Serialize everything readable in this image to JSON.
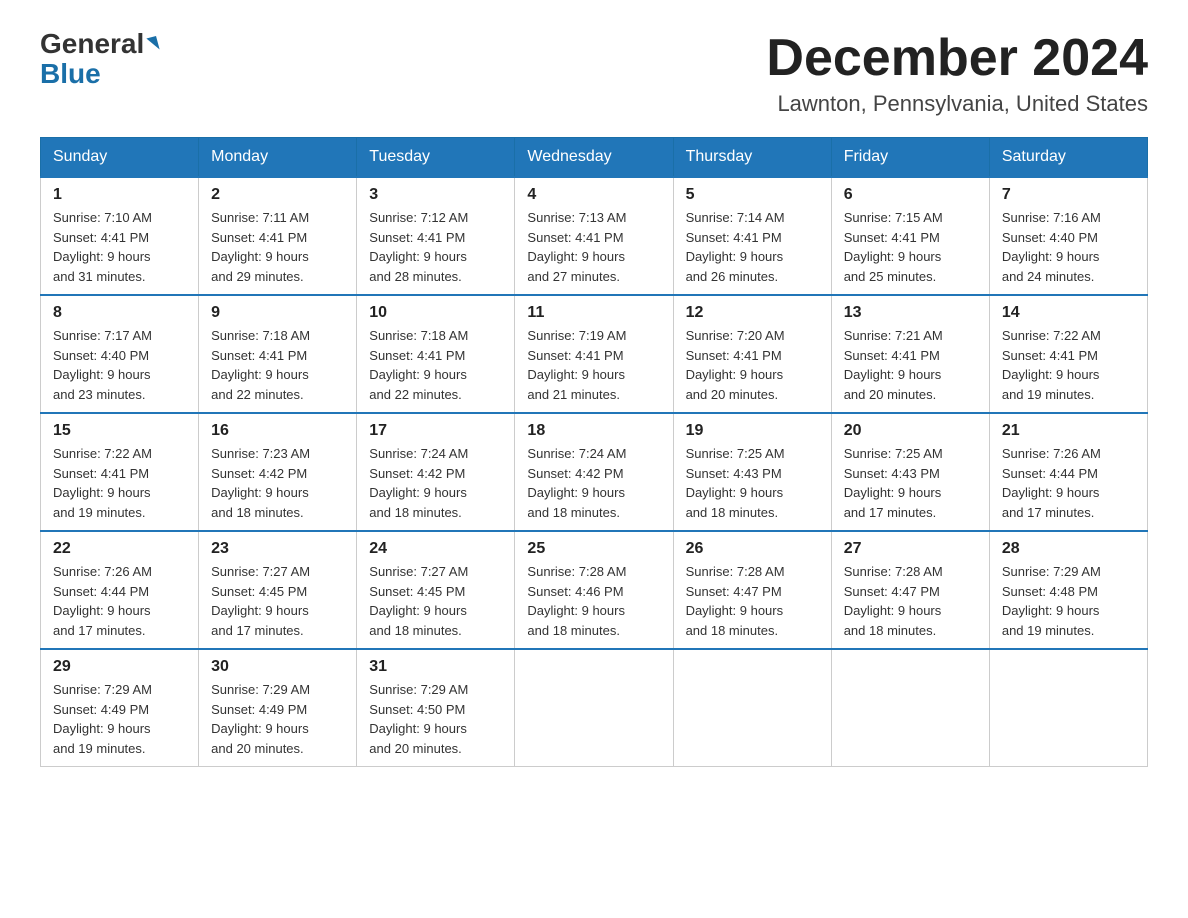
{
  "header": {
    "logo_general": "General",
    "logo_blue": "Blue",
    "month_title": "December 2024",
    "location": "Lawnton, Pennsylvania, United States"
  },
  "days_of_week": [
    "Sunday",
    "Monday",
    "Tuesday",
    "Wednesday",
    "Thursday",
    "Friday",
    "Saturday"
  ],
  "weeks": [
    [
      {
        "day": 1,
        "sunrise": "7:10 AM",
        "sunset": "4:41 PM",
        "daylight": "9 hours and 31 minutes."
      },
      {
        "day": 2,
        "sunrise": "7:11 AM",
        "sunset": "4:41 PM",
        "daylight": "9 hours and 29 minutes."
      },
      {
        "day": 3,
        "sunrise": "7:12 AM",
        "sunset": "4:41 PM",
        "daylight": "9 hours and 28 minutes."
      },
      {
        "day": 4,
        "sunrise": "7:13 AM",
        "sunset": "4:41 PM",
        "daylight": "9 hours and 27 minutes."
      },
      {
        "day": 5,
        "sunrise": "7:14 AM",
        "sunset": "4:41 PM",
        "daylight": "9 hours and 26 minutes."
      },
      {
        "day": 6,
        "sunrise": "7:15 AM",
        "sunset": "4:41 PM",
        "daylight": "9 hours and 25 minutes."
      },
      {
        "day": 7,
        "sunrise": "7:16 AM",
        "sunset": "4:40 PM",
        "daylight": "9 hours and 24 minutes."
      }
    ],
    [
      {
        "day": 8,
        "sunrise": "7:17 AM",
        "sunset": "4:40 PM",
        "daylight": "9 hours and 23 minutes."
      },
      {
        "day": 9,
        "sunrise": "7:18 AM",
        "sunset": "4:41 PM",
        "daylight": "9 hours and 22 minutes."
      },
      {
        "day": 10,
        "sunrise": "7:18 AM",
        "sunset": "4:41 PM",
        "daylight": "9 hours and 22 minutes."
      },
      {
        "day": 11,
        "sunrise": "7:19 AM",
        "sunset": "4:41 PM",
        "daylight": "9 hours and 21 minutes."
      },
      {
        "day": 12,
        "sunrise": "7:20 AM",
        "sunset": "4:41 PM",
        "daylight": "9 hours and 20 minutes."
      },
      {
        "day": 13,
        "sunrise": "7:21 AM",
        "sunset": "4:41 PM",
        "daylight": "9 hours and 20 minutes."
      },
      {
        "day": 14,
        "sunrise": "7:22 AM",
        "sunset": "4:41 PM",
        "daylight": "9 hours and 19 minutes."
      }
    ],
    [
      {
        "day": 15,
        "sunrise": "7:22 AM",
        "sunset": "4:41 PM",
        "daylight": "9 hours and 19 minutes."
      },
      {
        "day": 16,
        "sunrise": "7:23 AM",
        "sunset": "4:42 PM",
        "daylight": "9 hours and 18 minutes."
      },
      {
        "day": 17,
        "sunrise": "7:24 AM",
        "sunset": "4:42 PM",
        "daylight": "9 hours and 18 minutes."
      },
      {
        "day": 18,
        "sunrise": "7:24 AM",
        "sunset": "4:42 PM",
        "daylight": "9 hours and 18 minutes."
      },
      {
        "day": 19,
        "sunrise": "7:25 AM",
        "sunset": "4:43 PM",
        "daylight": "9 hours and 18 minutes."
      },
      {
        "day": 20,
        "sunrise": "7:25 AM",
        "sunset": "4:43 PM",
        "daylight": "9 hours and 17 minutes."
      },
      {
        "day": 21,
        "sunrise": "7:26 AM",
        "sunset": "4:44 PM",
        "daylight": "9 hours and 17 minutes."
      }
    ],
    [
      {
        "day": 22,
        "sunrise": "7:26 AM",
        "sunset": "4:44 PM",
        "daylight": "9 hours and 17 minutes."
      },
      {
        "day": 23,
        "sunrise": "7:27 AM",
        "sunset": "4:45 PM",
        "daylight": "9 hours and 17 minutes."
      },
      {
        "day": 24,
        "sunrise": "7:27 AM",
        "sunset": "4:45 PM",
        "daylight": "9 hours and 18 minutes."
      },
      {
        "day": 25,
        "sunrise": "7:28 AM",
        "sunset": "4:46 PM",
        "daylight": "9 hours and 18 minutes."
      },
      {
        "day": 26,
        "sunrise": "7:28 AM",
        "sunset": "4:47 PM",
        "daylight": "9 hours and 18 minutes."
      },
      {
        "day": 27,
        "sunrise": "7:28 AM",
        "sunset": "4:47 PM",
        "daylight": "9 hours and 18 minutes."
      },
      {
        "day": 28,
        "sunrise": "7:29 AM",
        "sunset": "4:48 PM",
        "daylight": "9 hours and 19 minutes."
      }
    ],
    [
      {
        "day": 29,
        "sunrise": "7:29 AM",
        "sunset": "4:49 PM",
        "daylight": "9 hours and 19 minutes."
      },
      {
        "day": 30,
        "sunrise": "7:29 AM",
        "sunset": "4:49 PM",
        "daylight": "9 hours and 20 minutes."
      },
      {
        "day": 31,
        "sunrise": "7:29 AM",
        "sunset": "4:50 PM",
        "daylight": "9 hours and 20 minutes."
      },
      null,
      null,
      null,
      null
    ]
  ],
  "labels": {
    "sunrise": "Sunrise:",
    "sunset": "Sunset:",
    "daylight": "Daylight:"
  }
}
